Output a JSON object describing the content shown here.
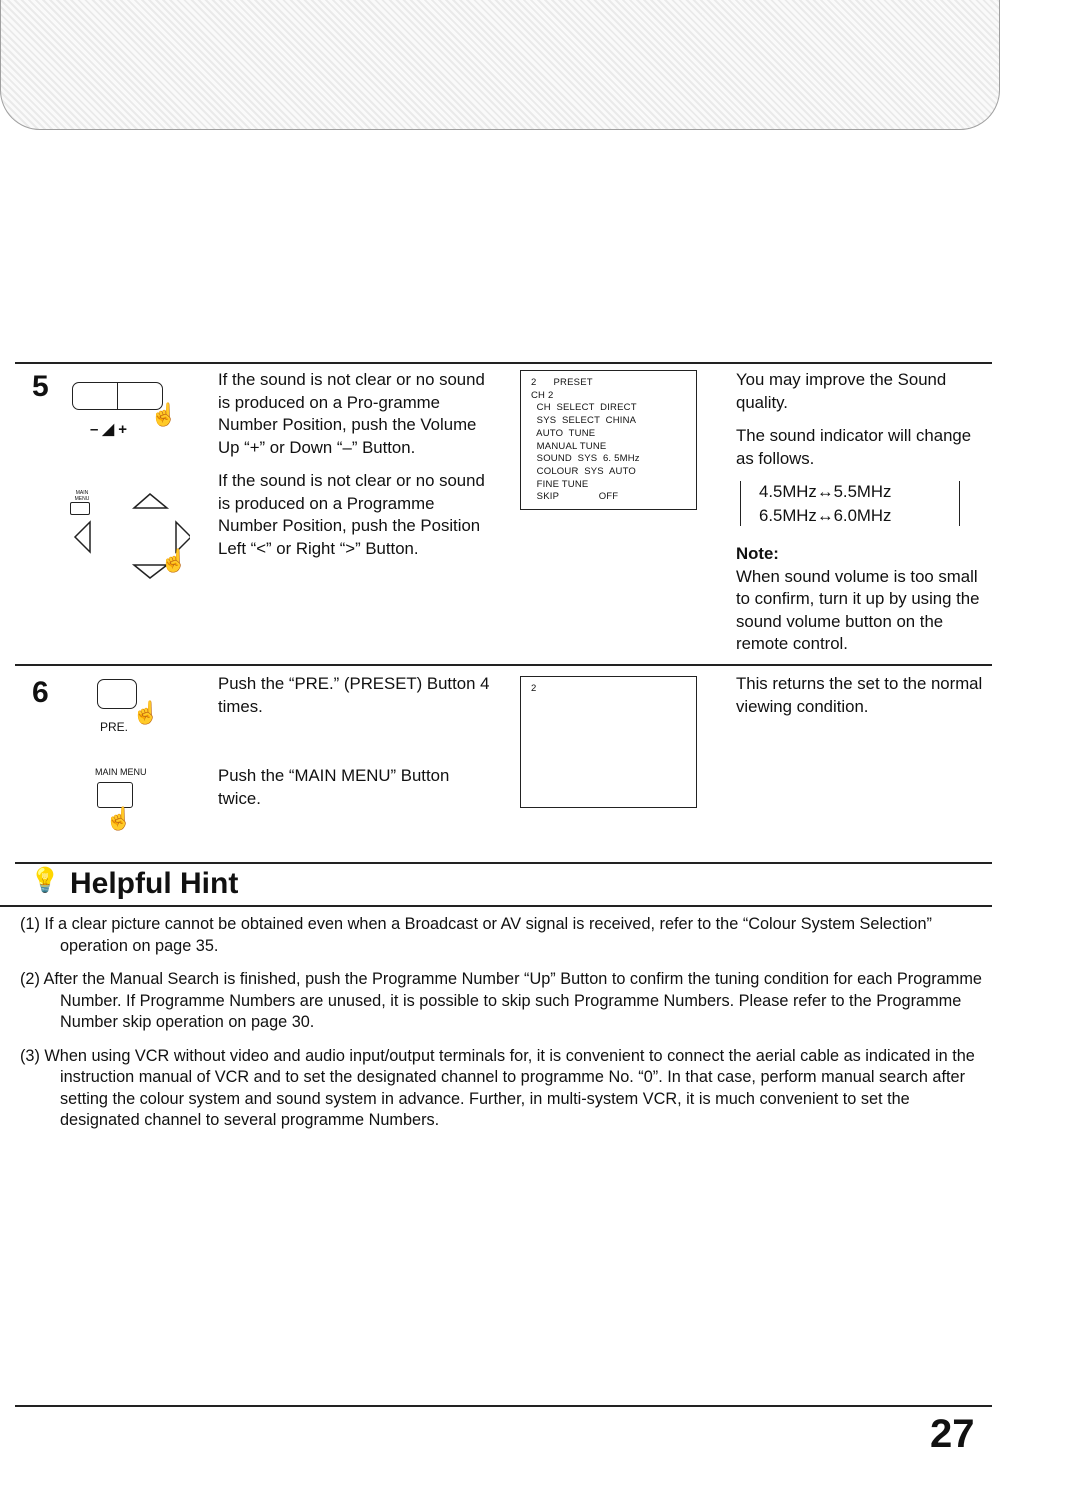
{
  "step5": {
    "number": "5",
    "volume_label": "– ◢ +",
    "main_menu_label": "MAIN MENU",
    "para1": "If the sound is not clear or no sound is produced on a Pro-gramme Number Position, push the Volume Up “+” or Down “–” Button.",
    "para2": "If the sound is not clear or no sound is produced on a Programme Number Position, push the Position Left “<” or Right “>” Button.",
    "osd": [
      "2      PRESET",
      "CH 2",
      "  CH  SELECT  DIRECT",
      "  SYS  SELECT  CHINA",
      "  AUTO  TUNE",
      "  MANUAL TUNE",
      "  SOUND  SYS  6. 5MHz",
      "  COLOUR  SYS  AUTO",
      "  FINE TUNE",
      "  SKIP              OFF"
    ],
    "right_p1": "You may improve the Sound quality.",
    "right_p2": "The sound indicator will change as follows.",
    "cycle_row1": "4.5MHz↔5.5MHz",
    "cycle_row2": "6.5MHz↔6.0MHz",
    "note_label": "Note:",
    "note_text": "When sound volume is too small to confirm, turn it up by using the sound volume button on the remote control."
  },
  "step6": {
    "number": "6",
    "pre_label": "PRE.",
    "main_menu_label": "MAIN MENU",
    "para1": "Push the “PRE.” (PRESET) Button 4 times.",
    "para2": "Push the “MAIN MENU” Button twice.",
    "osd": "2",
    "right_text": "This returns the set to the normal viewing condition."
  },
  "hint": {
    "title": "Helpful Hint",
    "items": [
      "(1) If a clear picture cannot be obtained even when a Broadcast or AV signal is received, refer to the “Colour System Selection” operation on page 35.",
      "(2) After the Manual Search is finished, push the Programme Number “Up” Button to confirm the tuning condition for each Programme Number. If Programme Numbers are unused, it is possible to skip such Programme Numbers. Please refer to the Programme Number skip operation on page 30.",
      "(3) When using VCR without video and audio input/output terminals for, it is convenient to connect the aerial cable as indicated in the instruction manual of VCR and to set the designated channel to programme No. “0”. In that case, perform manual search after setting the colour system and sound system in advance. Further, in multi-system VCR, it is much convenient to set the designated channel to several programme Numbers."
    ]
  },
  "page_number": "27"
}
